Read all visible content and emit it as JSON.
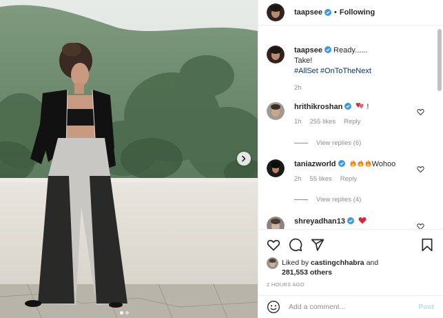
{
  "post": {
    "author": "taapsee",
    "separator": "•",
    "following_label": "Following"
  },
  "caption": {
    "username": "taapsee",
    "line1": "Ready......",
    "line2": "Take!",
    "hashtags": [
      "#AllSet",
      "#OnToTheNext"
    ],
    "time": "2h"
  },
  "comments": [
    {
      "username": "hrithikroshan",
      "text": "!",
      "emoji": "pink-hearts",
      "time": "1h",
      "likes": "255 likes",
      "reply_label": "Reply",
      "view_replies": "View replies (6)"
    },
    {
      "username": "taniazworld",
      "text": "Wohoo",
      "emoji": "fire x3",
      "time": "2h",
      "likes": "55 likes",
      "reply_label": "Reply",
      "view_replies": "View replies (4)"
    },
    {
      "username": "shreyadhan13",
      "text": "",
      "emoji": "red-heart",
      "time": "",
      "likes": "",
      "reply_label": "",
      "view_replies": ""
    }
  ],
  "likes": {
    "prefix": "Liked by",
    "user": "castingchhabra",
    "middle": "and",
    "count": "281,553 others"
  },
  "timestamp": "2 HOURS AGO",
  "add_comment": {
    "placeholder": "Add a comment...",
    "post_label": "Post"
  },
  "carousel": {
    "current": 1,
    "total": 2
  },
  "colors": {
    "verified": "#3897f0",
    "link": "#00376b",
    "muted": "#8e8e8e",
    "post_button": "#b2dffc",
    "heart_red": "#ed4956"
  },
  "icons": [
    "heart-icon",
    "comment-icon",
    "share-icon",
    "bookmark-icon",
    "emoji-icon",
    "verified-icon",
    "chevron-right-icon"
  ]
}
